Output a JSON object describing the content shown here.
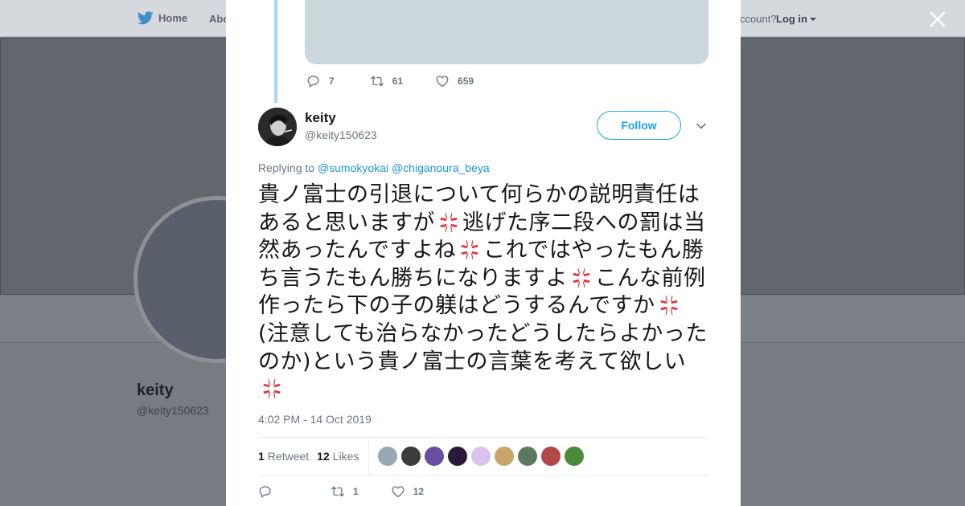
{
  "nav": {
    "home_label": "Home",
    "about_label": "Abo",
    "account_label": "ccount?",
    "login_label": "Log in"
  },
  "profile": {
    "name": "keity",
    "handle": "@keity150623"
  },
  "previous_tweet": {
    "replies": "7",
    "retweets": "61",
    "likes": "659"
  },
  "tweet": {
    "author_name": "keity",
    "author_handle": "@keity150623",
    "follow_label": "Follow",
    "replying_prefix": "Replying to",
    "mentions": [
      "@sumokyokai",
      "@chiganoura_beya"
    ],
    "text_parts": [
      "貴ノ富士の引退について何らかの説明責任はあると思いますが",
      "逃げた序二段への罰は当然あったんですよね",
      "これではやったもん勝ち言うたもん勝ちになりますよ",
      "こんな前例作ったら下の子の躾はどうするんですか",
      "(注意しても治らなかったどうしたらよかったのか)という貴ノ富士の言葉を考えて欲しい",
      ""
    ],
    "emoji_name": "anger-symbol-emoji",
    "timestamp": "4:02 PM - 14 Oct 2019",
    "retweet_count": "1",
    "retweet_label": "Retweet",
    "like_count": "12",
    "like_label": "Likes",
    "action_retweets": "1",
    "action_likes": "12"
  },
  "likers": [
    {
      "name": "liker-avatar-1",
      "color": "#9aa7b4"
    },
    {
      "name": "liker-avatar-2",
      "color": "#3b3b3b"
    },
    {
      "name": "liker-avatar-3",
      "color": "#6a4fa0"
    },
    {
      "name": "liker-avatar-4",
      "color": "#2a1a3a"
    },
    {
      "name": "liker-avatar-5",
      "color": "#d9c2ec"
    },
    {
      "name": "liker-avatar-6",
      "color": "#c9a46a"
    },
    {
      "name": "liker-avatar-7",
      "color": "#5a7a5e"
    },
    {
      "name": "liker-avatar-8",
      "color": "#b24848"
    },
    {
      "name": "liker-avatar-9",
      "color": "#4a8a3a"
    }
  ],
  "colors": {
    "accent": "#1da1f2",
    "link": "#1b95e0",
    "muted": "#657786",
    "text": "#14171a"
  }
}
